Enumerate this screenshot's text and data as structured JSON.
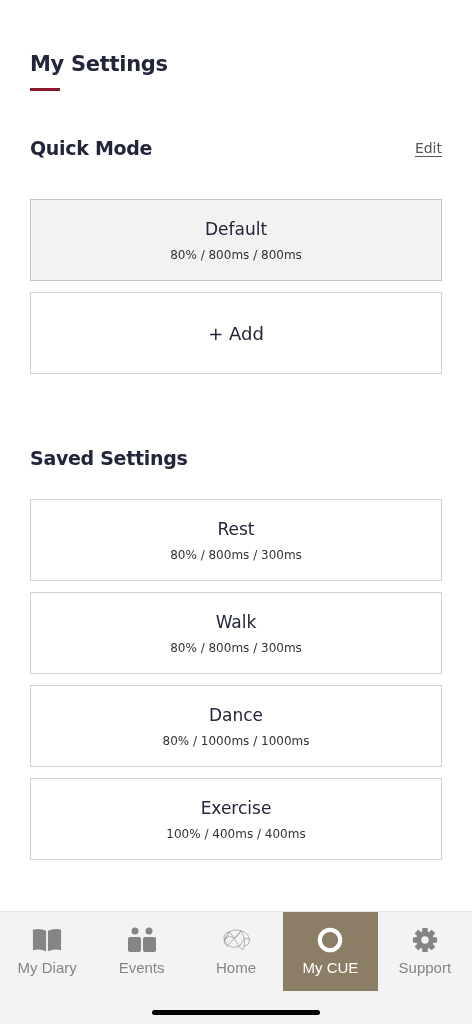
{
  "title": "My Settings",
  "quick_mode": {
    "heading": "Quick Mode",
    "edit_link": "Edit",
    "presets": [
      {
        "name": "Default",
        "values": "80% / 800ms / 800ms",
        "selected": true
      }
    ],
    "add_button": {
      "icon": "+",
      "label": "Add"
    }
  },
  "saved_settings": {
    "heading": "Saved Settings",
    "presets": [
      {
        "name": "Rest",
        "values": "80% / 800ms / 300ms",
        "selected": false
      },
      {
        "name": "Walk",
        "values": "80% / 800ms / 300ms",
        "selected": false
      },
      {
        "name": "Dance",
        "values": "80% / 1000ms / 1000ms",
        "selected": false
      },
      {
        "name": "Exercise",
        "values": "100% / 400ms / 400ms",
        "selected": false
      }
    ]
  },
  "tab_bar": [
    {
      "label": "My Diary",
      "kind": "book",
      "selected": false
    },
    {
      "label": "Events",
      "kind": "people",
      "selected": false
    },
    {
      "label": "Home",
      "kind": "brain",
      "selected": false
    },
    {
      "label": "My CUE",
      "kind": "ring",
      "selected": true
    },
    {
      "label": "Support",
      "kind": "gear",
      "selected": false
    }
  ]
}
